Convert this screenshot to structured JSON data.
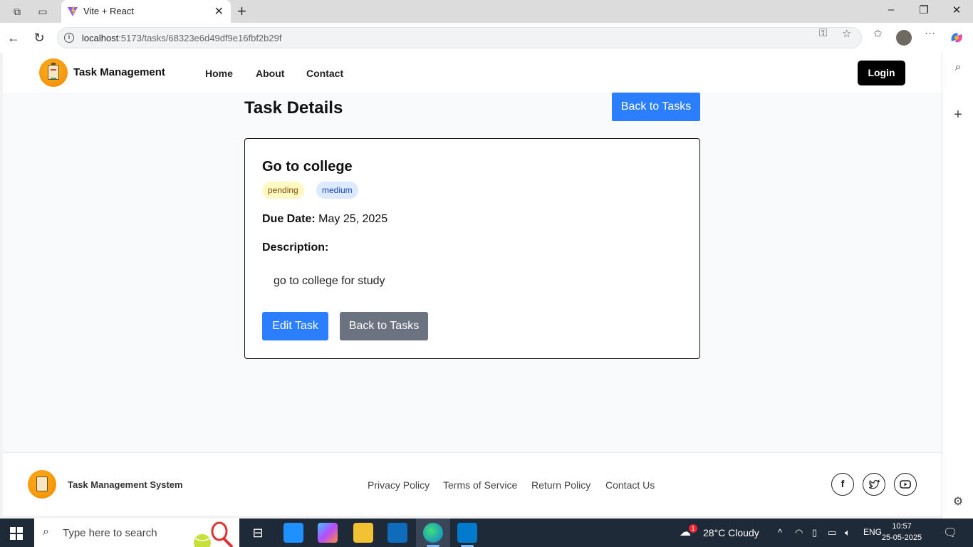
{
  "browser": {
    "tab_title": "Vite + React",
    "url_host": "localhost",
    "url_rest": ":5173/tasks/68323e6d49df9e16fbf2b29f"
  },
  "header": {
    "brand": "Task Management",
    "nav": [
      "Home",
      "About",
      "Contact"
    ],
    "login_label": "Login"
  },
  "page": {
    "title": "Task Details",
    "back_top_label": "Back to Tasks"
  },
  "task": {
    "title": "Go to college",
    "status": "pending",
    "priority": "medium",
    "due_label": "Due Date:",
    "due_value": "May 25, 2025",
    "description_label": "Description:",
    "description": "go to college for study",
    "edit_label": "Edit Task",
    "back_label": "Back to Tasks"
  },
  "footer": {
    "brand": "Task Management System",
    "links": [
      "Privacy Policy",
      "Terms of Service",
      "Return Policy",
      "Contact Us"
    ],
    "social": [
      "facebook-icon",
      "twitter-icon",
      "youtube-icon"
    ]
  },
  "taskbar": {
    "search_placeholder": "Type here to search",
    "weather_badge": "1",
    "weather": "28°C  Cloudy",
    "lang": "ENG",
    "time": "10:57",
    "date": "25-05-2025"
  },
  "colors": {
    "primary": "#2b7fff",
    "secondary": "#6b7280",
    "pending_bg": "#fef9c3",
    "medium_bg": "#dbeafe"
  }
}
